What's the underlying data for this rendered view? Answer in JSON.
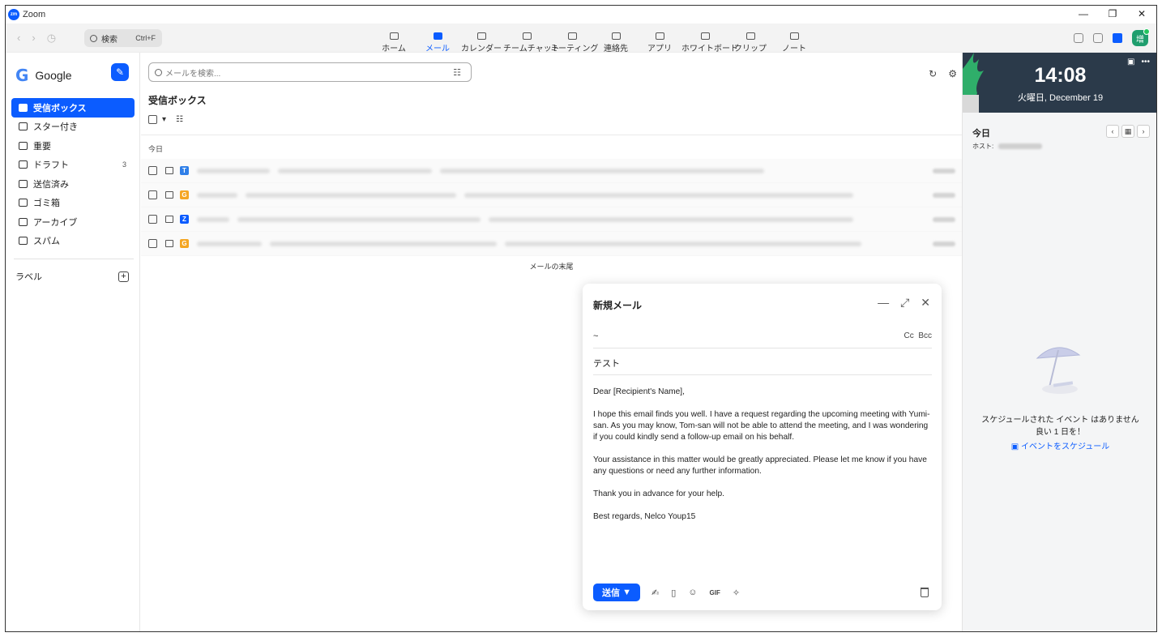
{
  "window": {
    "title": "Zoom",
    "controls": [
      "—",
      "❐",
      "✕"
    ]
  },
  "nav": {
    "search_label": "検索",
    "search_shortcut": "Ctrl+F",
    "tabs": [
      "ホーム",
      "メール",
      "カレンダー",
      "チームチャット",
      "ミーティング",
      "連絡先",
      "アプリ",
      "ホワイトボード",
      "クリップ",
      "ノート"
    ],
    "active_tab": "メール",
    "avatar_initial": "增"
  },
  "sidebar": {
    "account": "Google",
    "folders": [
      {
        "label": "受信ボックス",
        "count": ""
      },
      {
        "label": "スター付き",
        "count": ""
      },
      {
        "label": "重要",
        "count": ""
      },
      {
        "label": "ドラフト",
        "count": "3"
      },
      {
        "label": "送信済み",
        "count": ""
      },
      {
        "label": "ゴミ箱",
        "count": ""
      },
      {
        "label": "アーカイブ",
        "count": ""
      },
      {
        "label": "スパム",
        "count": ""
      }
    ],
    "labels_heading": "ラベル"
  },
  "main": {
    "search_placeholder": "メールを検索...",
    "inbox_title": "受信ボックス",
    "section_today": "今日",
    "rows": [
      {
        "avatar": "T",
        "color": "#2f7fe8"
      },
      {
        "avatar": "G",
        "color": "#f5a623"
      },
      {
        "avatar": "Z",
        "color": "#0b5cff"
      },
      {
        "avatar": "G",
        "color": "#f5a623"
      }
    ],
    "end_label": "メールの末尾"
  },
  "compose": {
    "title": "新規メール",
    "to_value": "~",
    "cc": "Cc",
    "bcc": "Bcc",
    "subject": "テスト",
    "body": [
      "Dear [Recipient's Name],",
      "I hope this email finds you well. I have a request regarding the upcoming meeting with Yumi-san. As you may know, Tom-san will not be able to attend the meeting, and I was wondering if you could kindly send a follow-up email on his behalf.",
      "Your assistance in this matter would be greatly appreciated. Please let me know if you have any questions or need any further information.",
      "Thank you in advance for your help.",
      "Best regards, Nelco Youp15"
    ],
    "send_label": "送信",
    "gif_label": "GIF"
  },
  "calendar": {
    "time": "14:08",
    "date": "火曜日, December 19",
    "today_label": "今日",
    "host_label": "ホスト:",
    "empty_line1": "スケジュールされた イベント はありません",
    "empty_line2": "良い 1 日を！",
    "schedule_link": "イベントをスケジュール"
  }
}
